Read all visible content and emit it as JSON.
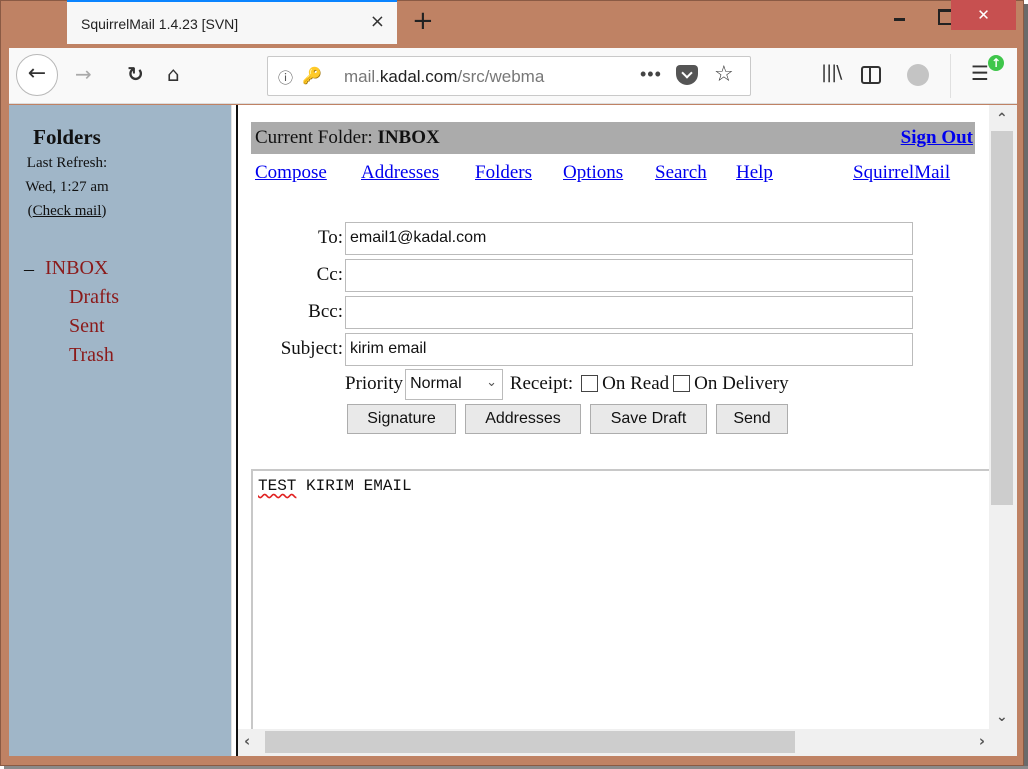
{
  "browser": {
    "tab_title": "SquirrelMail 1.4.23 [SVN]",
    "tab_close_icon": "×",
    "new_tab_icon": "+",
    "window_close_icon": "✕",
    "url": {
      "prefix": "mail.",
      "domain": "kadal.com",
      "path": "/src/webma"
    },
    "icons": {
      "back": "←",
      "forward": "→",
      "reload": "↻",
      "home": "⌂",
      "info": "ⓘ",
      "key": "🔑",
      "more": "•••",
      "star": "☆",
      "library": "|||\\",
      "menu": "☰",
      "update": "↑"
    }
  },
  "sidebar": {
    "title": "Folders",
    "last_refresh_label": "Last Refresh:",
    "last_refresh_time": "Wed, 1:27 am",
    "check_mail_open": "(",
    "check_mail_link": "Check mail",
    "check_mail_close": ")",
    "collapse_toggle": "–",
    "folders": [
      {
        "label": "INBOX"
      },
      {
        "label": "Drafts"
      },
      {
        "label": "Sent"
      },
      {
        "label": "Trash"
      }
    ]
  },
  "header": {
    "current_folder_label": "Current Folder: ",
    "current_folder": "INBOX",
    "sign_out": "Sign Out",
    "nav": [
      {
        "label": "Compose"
      },
      {
        "label": "Addresses"
      },
      {
        "label": "Folders"
      },
      {
        "label": "Options"
      },
      {
        "label": "Search"
      },
      {
        "label": "Help"
      }
    ],
    "brand_link": "SquirrelMail"
  },
  "compose": {
    "to_label": "To:",
    "to_value": "email1@kadal.com",
    "cc_label": "Cc:",
    "cc_value": "",
    "bcc_label": "Bcc:",
    "bcc_value": "",
    "subject_label": "Subject:",
    "subject_value": "kirim email",
    "priority_label": "Priority",
    "priority_value": "Normal",
    "receipt_label": "Receipt:",
    "on_read_label": "On Read",
    "on_read_checked": false,
    "on_delivery_label": "On Delivery",
    "on_delivery_checked": false,
    "buttons": {
      "signature": "Signature",
      "addresses": "Addresses",
      "save_draft": "Save Draft",
      "send": "Send"
    },
    "body_first_word": "TEST",
    "body_rest": " KIRIM EMAIL"
  },
  "scrollbars": {
    "up": "⌃",
    "down": "⌄",
    "left": "‹",
    "right": "›"
  },
  "colors": {
    "window_frame": "#bf8264",
    "sidebar_bg": "#a0b6c8",
    "folder_link": "#8b1a1a",
    "link_blue": "#0000ee",
    "folder_bar": "#ababab",
    "close_button": "#c75050"
  }
}
